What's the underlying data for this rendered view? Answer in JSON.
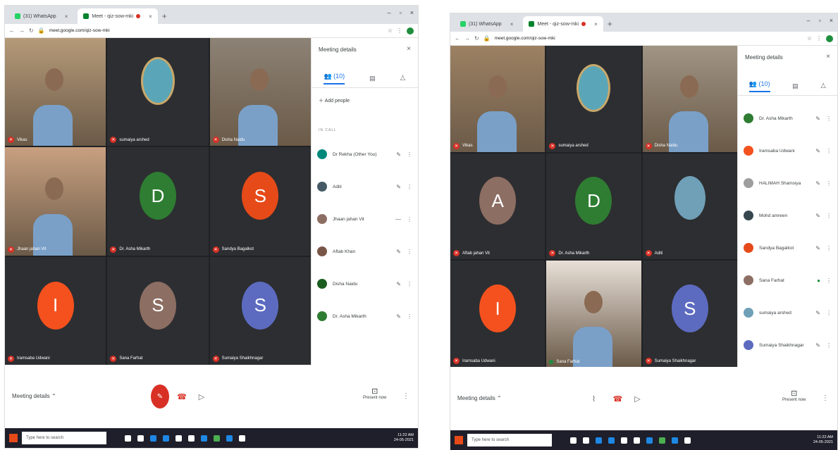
{
  "screens": [
    {
      "id": "left",
      "tabs": [
        {
          "label": "(31) WhatsApp",
          "active": false,
          "color": "#25d366"
        },
        {
          "label": "Meet - qiz-sow-mki",
          "active": true,
          "color": "#00832d"
        }
      ],
      "url": "meet.google.com/qiz-sow-mki",
      "tiles": [
        {
          "name": "Vikas",
          "type": "video",
          "bg": "#b59a78"
        },
        {
          "name": "sumaiya arshed",
          "type": "video",
          "bg": "#2d2e31"
        },
        {
          "name": "Disha Naidu",
          "type": "video",
          "bg": "#8c8275"
        },
        {
          "name": "Jhaan jahan Vit",
          "type": "video",
          "bg": "#c8a080"
        },
        {
          "name": "Dr. Asha Mikarth",
          "type": "avatar",
          "letter": "D",
          "color": "#2e7d32"
        },
        {
          "name": "Sandya Bagalkot",
          "type": "avatar",
          "letter": "S",
          "color": "#e64a19"
        },
        {
          "name": "Iramsaba Udwani",
          "type": "avatar",
          "letter": "I",
          "color": "#f4511e"
        },
        {
          "name": "Sana Farhat",
          "type": "avatar",
          "letter": "S",
          "color": "#8d6e63"
        },
        {
          "name": "Sumaiya Shaikhnagar",
          "type": "avatar",
          "letter": "S",
          "color": "#5c6bc0"
        }
      ],
      "panel": {
        "title": "Meeting details",
        "tab_people": "(10)",
        "add_people": "Add people",
        "in_call": "IN CALL",
        "people": [
          {
            "name": "Dr Rekha (Other You)",
            "color": "#00897b",
            "mic": "✎"
          },
          {
            "name": "Aditi",
            "color": "#455a64",
            "mic": "✎"
          },
          {
            "name": "Jhaan jahan Vit",
            "color": "#8d6e63",
            "mic": "—"
          },
          {
            "name": "Aftab Khan",
            "color": "#795548",
            "mic": "✎"
          },
          {
            "name": "Disha Naidu",
            "color": "#1b5e20",
            "mic": "✎"
          },
          {
            "name": "Dr. Asha Mikarth",
            "color": "#2e7d32",
            "mic": "✎"
          }
        ]
      },
      "controls": {
        "meeting_details": "Meeting details",
        "present": "Present now"
      },
      "taskbar": {
        "search": "Type here to search",
        "time": "11:22 AM",
        "date": "24-05-2021"
      }
    },
    {
      "id": "right",
      "tabs": [
        {
          "label": "(31) WhatsApp",
          "active": false,
          "color": "#25d366"
        },
        {
          "label": "Meet - qiz-sow-mki",
          "active": true,
          "color": "#00832d"
        }
      ],
      "url": "meet.google.com/qiz-sow-mki",
      "tiles": [
        {
          "name": "Vikas",
          "type": "video",
          "bg": "#9c8163"
        },
        {
          "name": "sumaiya arshed",
          "type": "video",
          "bg": "#2d2e31"
        },
        {
          "name": "Disha Naidu",
          "type": "video",
          "bg": "#a09484"
        },
        {
          "name": "Aftab jahan Vit",
          "type": "avatar",
          "letter": "A",
          "color": "#8d6e63"
        },
        {
          "name": "Dr. Asha Mikarth",
          "type": "avatar",
          "letter": "D",
          "color": "#2e7d32"
        },
        {
          "name": "Aditi",
          "type": "photo",
          "bg": "#6fa0b8"
        },
        {
          "name": "Iramsaba Udwani",
          "type": "avatar",
          "letter": "I",
          "color": "#f4511e"
        },
        {
          "name": "Sana Farhat",
          "type": "video",
          "bg": "#e8e0d8"
        },
        {
          "name": "Sumaiya Shaikhnagar",
          "type": "avatar",
          "letter": "S",
          "color": "#5c6bc0"
        }
      ],
      "panel": {
        "title": "Meeting details",
        "tab_people": "(10)",
        "add_people": "",
        "in_call": "",
        "people": [
          {
            "name": "Dr. Asha Mikarth",
            "color": "#2e7d32",
            "mic": "✎"
          },
          {
            "name": "Iramsaba Udwani",
            "color": "#f4511e",
            "mic": "✎"
          },
          {
            "name": "HALIMAH Shamsiya",
            "color": "#9e9e9e",
            "mic": "✎"
          },
          {
            "name": "Mohd amreen",
            "color": "#37474f",
            "mic": "✎"
          },
          {
            "name": "Sandya Bagalkot",
            "color": "#e64a19",
            "mic": "✎"
          },
          {
            "name": "Sana Farhat",
            "color": "#8d6e63",
            "mic": "●"
          },
          {
            "name": "sumaiya arshed",
            "color": "#6fa0b8",
            "mic": "✎"
          },
          {
            "name": "Sumaiya Shaikhnagar",
            "color": "#5c6bc0",
            "mic": "✎"
          }
        ]
      },
      "controls": {
        "meeting_details": "Meeting details",
        "present": "Present now"
      },
      "taskbar": {
        "search": "Type here to search",
        "time": "11:22 AM",
        "date": "24-05-2021"
      }
    }
  ]
}
